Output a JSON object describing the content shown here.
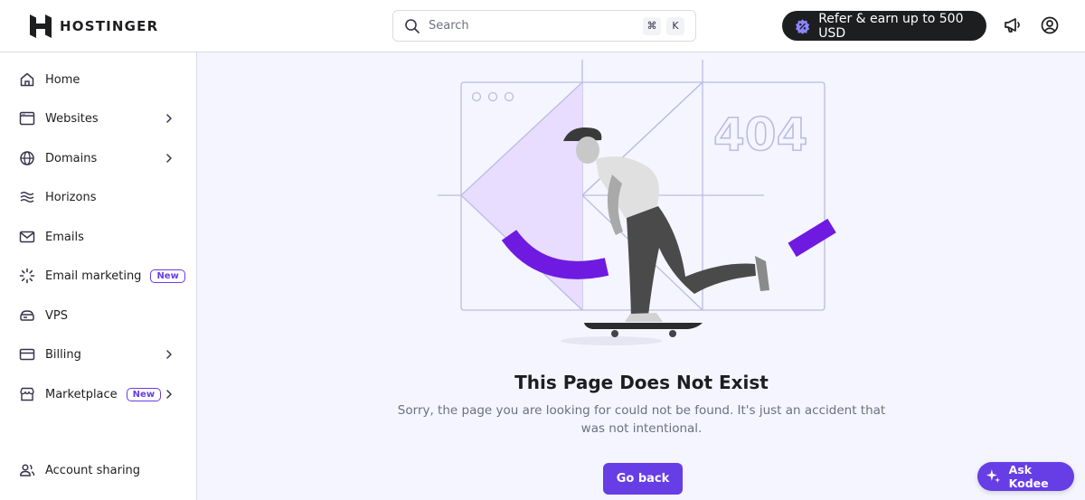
{
  "brand": {
    "name": "HOSTINGER"
  },
  "search": {
    "placeholder": "Search",
    "shortcut_cmd": "⌘",
    "shortcut_key": "K"
  },
  "header": {
    "refer_label": "Refer & earn up to 500 USD"
  },
  "sidebar": {
    "items": [
      {
        "label": "Home",
        "icon": "home-icon",
        "chevron": false
      },
      {
        "label": "Websites",
        "icon": "browser-window-icon",
        "chevron": true
      },
      {
        "label": "Domains",
        "icon": "globe-icon",
        "chevron": true
      },
      {
        "label": "Horizons",
        "icon": "horizons-waves-icon",
        "chevron": false
      },
      {
        "label": "Emails",
        "icon": "envelope-icon",
        "chevron": false
      },
      {
        "label": "Email marketing",
        "icon": "sparkle-loader-icon",
        "badge": "New",
        "chevron": false
      },
      {
        "label": "VPS",
        "icon": "server-icon",
        "chevron": false
      },
      {
        "label": "Billing",
        "icon": "credit-card-icon",
        "chevron": true
      },
      {
        "label": "Marketplace",
        "icon": "store-icon",
        "badge": "New",
        "chevron": true
      }
    ],
    "account_sharing": "Account sharing"
  },
  "error": {
    "code": "404",
    "title": "This Page Does Not Exist",
    "description": "Sorry, the page you are looking for could not be found. It's just an accident that was not intentional.",
    "button": "Go back"
  },
  "assistant": {
    "label": "Ask Kodee"
  },
  "colors": {
    "accent": "#673de6",
    "dark": "#1d1e20",
    "background": "#f4f5ff",
    "muted": "#6d7081"
  }
}
